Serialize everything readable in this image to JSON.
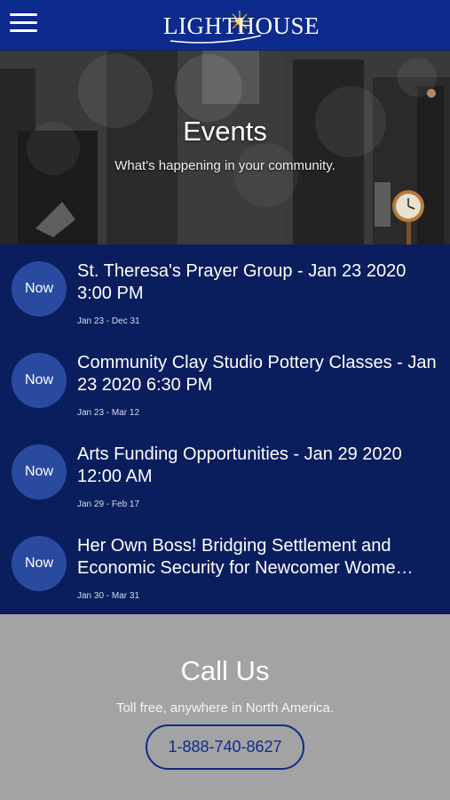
{
  "header": {
    "logo_text": "LIGHTHOUSE",
    "menu_icon": "hamburger-menu-icon",
    "brand_color": "#0d2b8c"
  },
  "hero": {
    "title": "Events",
    "subtitle": "What's happening in your community."
  },
  "events": [
    {
      "badge": "Now",
      "title": "St. Theresa's Prayer Group - Jan 23 2020 3:00 PM",
      "dates": "Jan 23 - Dec 31"
    },
    {
      "badge": "Now",
      "title": "Community Clay Studio Pottery Classes - Jan 23 2020 6:30 PM",
      "dates": "Jan 23 - Mar 12"
    },
    {
      "badge": "Now",
      "title": "Arts Funding Opportunities - Jan 29 2020 12:00 AM",
      "dates": "Jan 29 - Feb 17"
    },
    {
      "badge": "Now",
      "title": "Her Own Boss! Bridging Settlement and Economic Security for Newcomer Wome…",
      "dates": "Jan 30 - Mar 31"
    }
  ],
  "call": {
    "title": "Call Us",
    "subtitle": "Toll free, anywhere in North America.",
    "phone": "1-888-740-8627"
  },
  "colors": {
    "events_bg": "#0a1e5e",
    "badge_bg": "#2a4aa0",
    "footer_bg": "#a3a3a3"
  }
}
